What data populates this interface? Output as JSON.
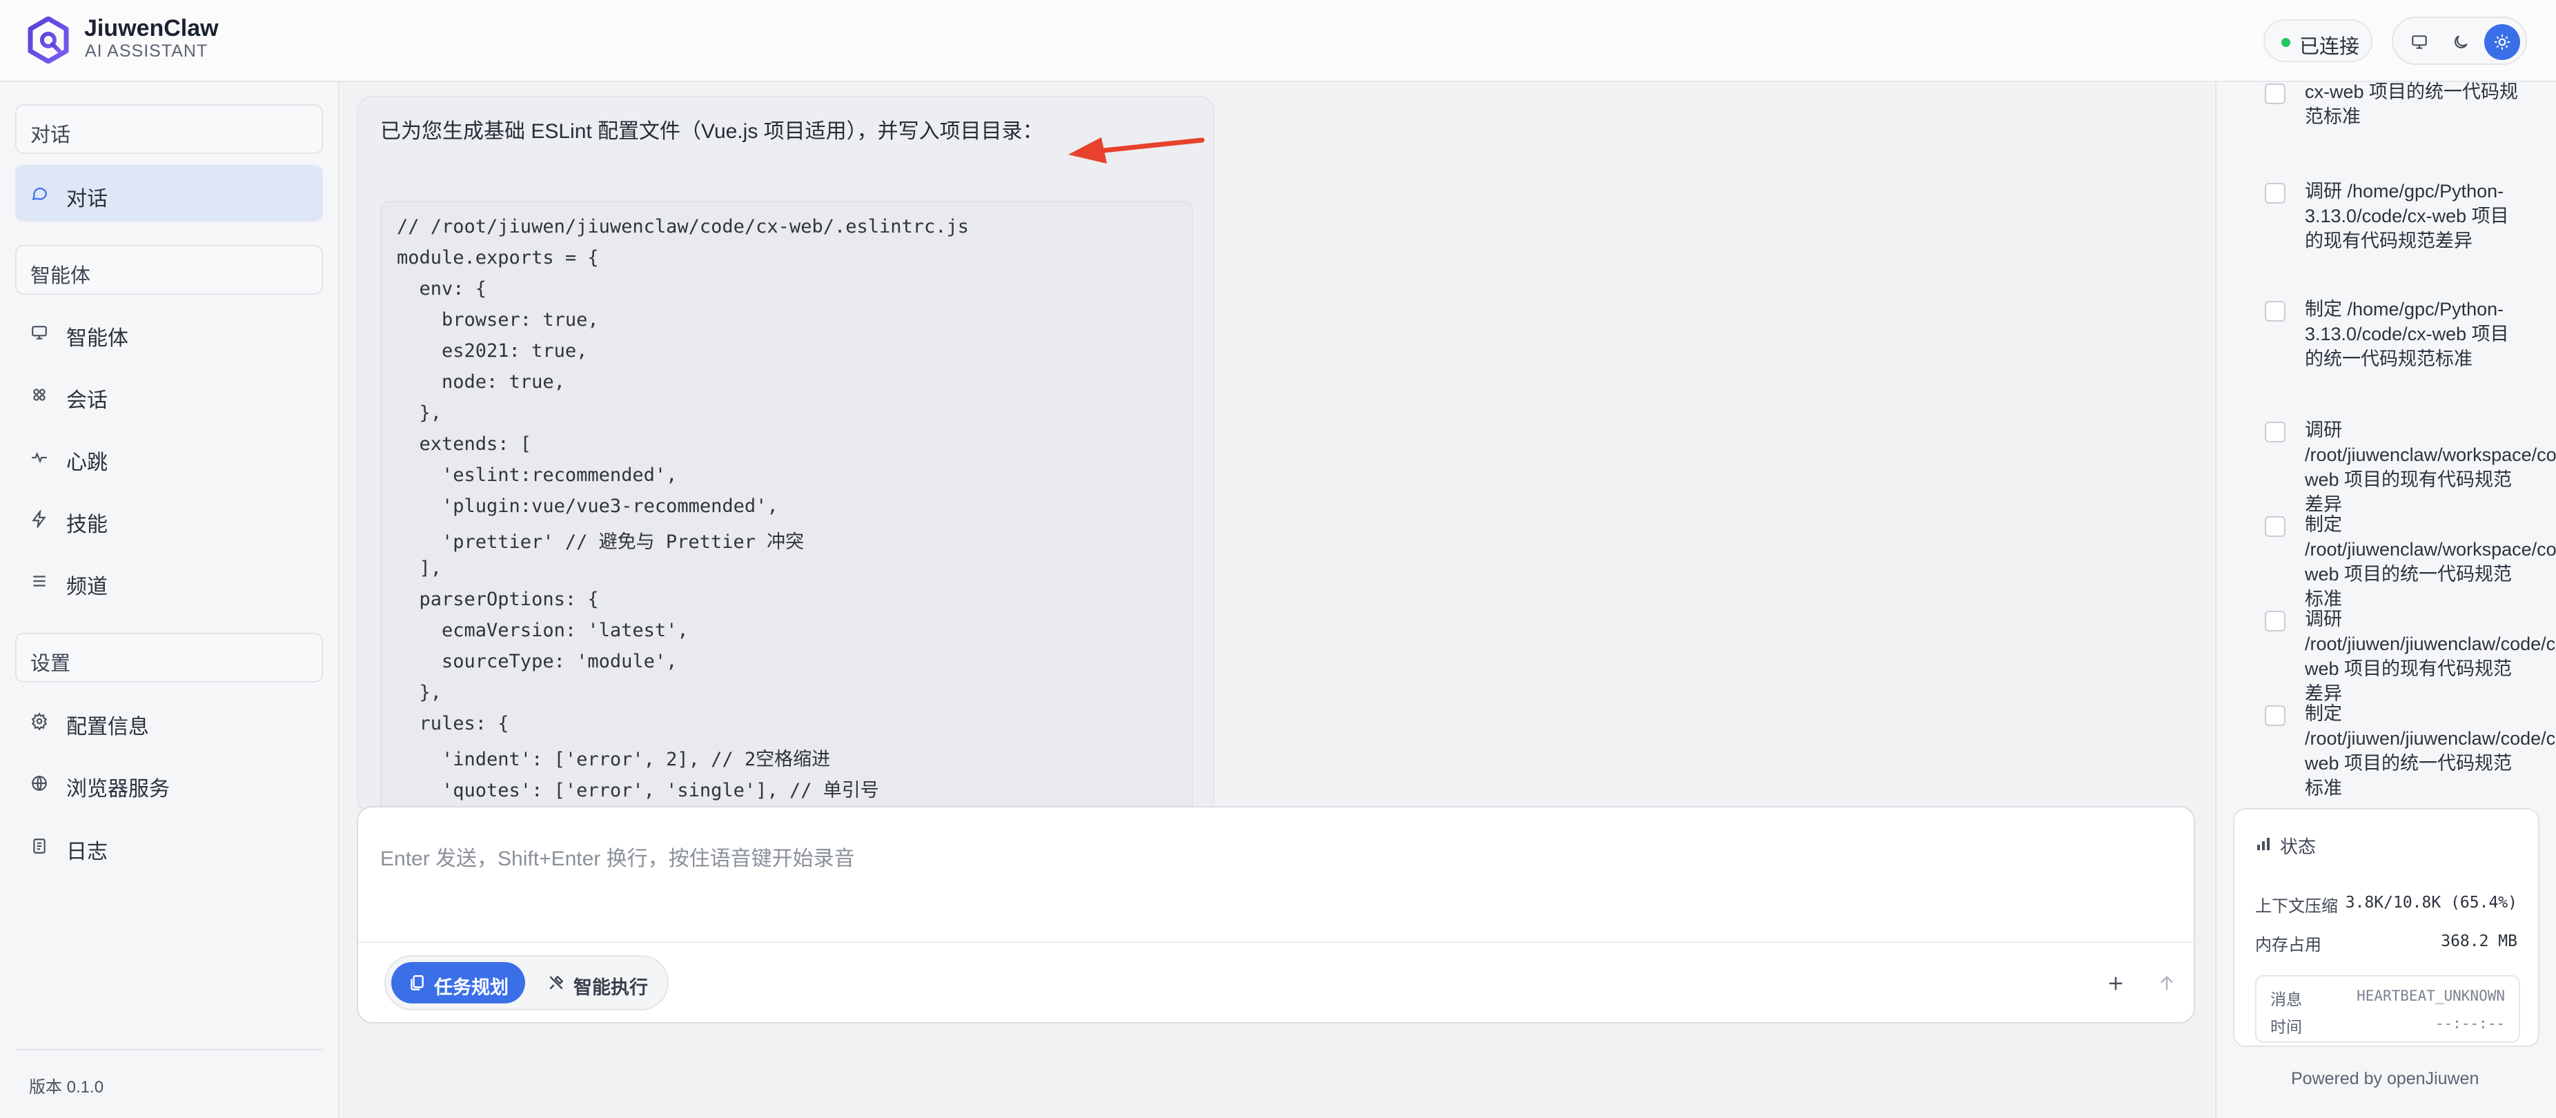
{
  "brand": {
    "name": "JiuwenClaw",
    "subtitle": "AI ASSISTANT"
  },
  "connection": {
    "status": "已连接",
    "color": "#22c55e"
  },
  "theme": {
    "options": [
      "desktop-icon",
      "moon-icon",
      "sun-icon"
    ],
    "active": "sun-icon"
  },
  "sidebar": {
    "sections": [
      {
        "title": "对话",
        "items": [
          {
            "label": "对话",
            "icon": "chat-bubble-icon",
            "active": true
          }
        ]
      },
      {
        "title": "智能体",
        "items": [
          {
            "label": "智能体",
            "icon": "monitor-icon"
          },
          {
            "label": "会话",
            "icon": "sessions-icon"
          },
          {
            "label": "心跳",
            "icon": "heartbeat-icon"
          },
          {
            "label": "技能",
            "icon": "lightning-icon"
          },
          {
            "label": "频道",
            "icon": "list-icon"
          }
        ]
      },
      {
        "title": "设置",
        "items": [
          {
            "label": "配置信息",
            "icon": "gear-icon"
          },
          {
            "label": "浏览器服务",
            "icon": "globe-icon"
          },
          {
            "label": "日志",
            "icon": "log-icon"
          }
        ]
      }
    ],
    "version": "版本 0.1.0"
  },
  "message": {
    "text": "已为您生成基础 ESLint 配置文件（Vue.js 项目适用），并写入项目目录：",
    "code_lines": [
      "// /root/jiuwen/jiuwenclaw/code/cx-web/.eslintrc.js",
      "module.exports = {",
      "  env: {",
      "    browser: true,",
      "    es2021: true,",
      "    node: true,",
      "  },",
      "  extends: [",
      "    'eslint:recommended',",
      "    'plugin:vue/vue3-recommended',",
      "    'prettier' // 避免与 Prettier 冲突",
      "  ],",
      "  parserOptions: {",
      "    ecmaVersion: 'latest',",
      "    sourceType: 'module',",
      "  },",
      "  rules: {",
      "    'indent': ['error', 2], // 2空格缩进",
      "    'quotes': ['error', 'single'], // 单引号"
    ]
  },
  "input": {
    "placeholder": "Enter 发送，Shift+Enter 换行，按住语音键开始录音",
    "value": "",
    "modes": [
      {
        "label": "任务规划",
        "icon": "task-plan-icon",
        "active": true
      },
      {
        "label": "智能执行",
        "icon": "tools-icon",
        "active": false
      }
    ],
    "accent": "#3b6fe8"
  },
  "todos": [
    "cx-web 项目的统一代码规范标准",
    "调研 /home/gpc/Python-3.13.0/code/cx-web 项目的现有代码规范差异",
    "制定 /home/gpc/Python-3.13.0/code/cx-web 项目的统一代码规范标准",
    "调研 /root/jiuwenclaw/workspace/code/cx-web 项目的现有代码规范差异",
    "制定 /root/jiuwenclaw/workspace/code/cx-web 项目的统一代码规范标准",
    "调研 /root/jiuwen/jiuwenclaw/code/cx-web 项目的现有代码规范差异",
    "制定 /root/jiuwen/jiuwenclaw/code/cx-web 项目的统一代码规范标准"
  ],
  "status": {
    "title": "状态",
    "context_label": "上下文压缩",
    "context_value": "3.8K/10.8K (65.4%)",
    "memory_label": "内存占用",
    "memory_value": "368.2 MB",
    "message_label": "消息",
    "message_value": "HEARTBEAT_UNKNOWN",
    "time_label": "时间",
    "time_value": "--:--:--"
  },
  "powered_by": "Powered by openJiuwen"
}
